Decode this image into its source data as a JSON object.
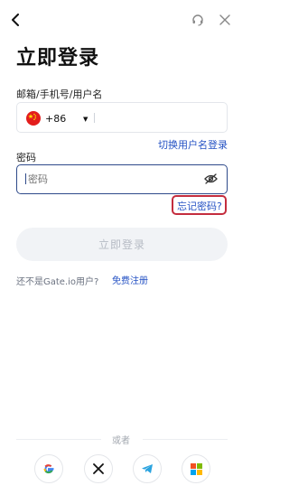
{
  "header": {
    "back_icon": "chevron-left-icon",
    "support_icon": "headset-icon",
    "close_icon": "close-icon"
  },
  "title": "立即登录",
  "account": {
    "label": "邮箱/手机号/用户名",
    "country_flag": "china-flag-icon",
    "country_code": "+86",
    "value": "",
    "switch_link": "切换用户名登录"
  },
  "password": {
    "label": "密码",
    "placeholder": "密码",
    "toggle_icon": "eye-off-icon",
    "forgot_link": "忘记密码?"
  },
  "login_button": "立即登录",
  "register": {
    "prompt": "还不是Gate.io用户?",
    "link": "免费注册"
  },
  "divider_text": "或者",
  "social": [
    {
      "name": "google-icon"
    },
    {
      "name": "x-icon"
    },
    {
      "name": "telegram-icon"
    },
    {
      "name": "microsoft-icon"
    }
  ],
  "colors": {
    "accent": "#2552c4",
    "focus_border": "#2e4a8a",
    "highlight": "#c42d3e",
    "flag_red": "#e31d1c"
  }
}
